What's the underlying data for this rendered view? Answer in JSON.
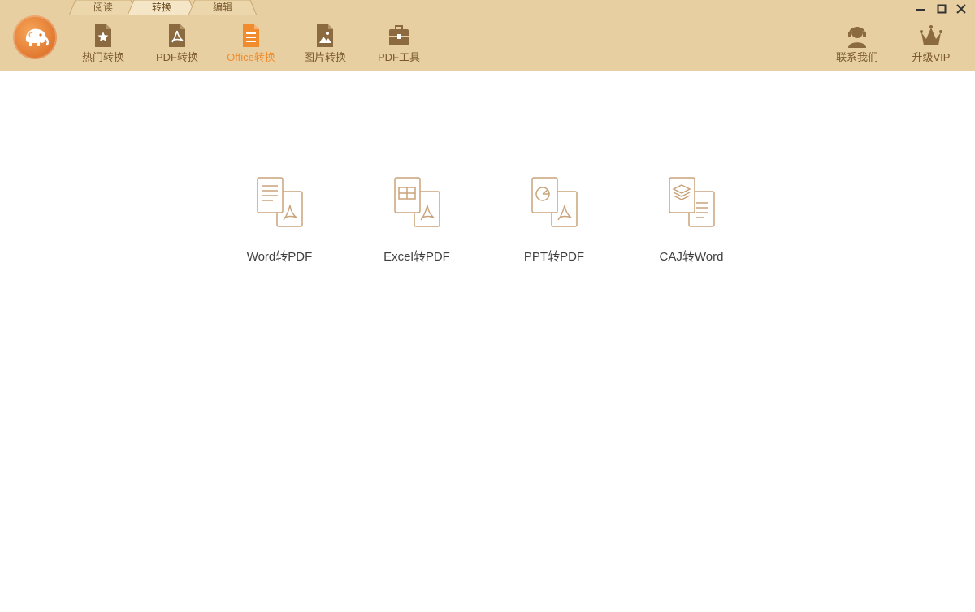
{
  "window": {
    "tabs": [
      {
        "label": "阅读",
        "active": false
      },
      {
        "label": "转换",
        "active": true
      },
      {
        "label": "编辑",
        "active": false
      }
    ],
    "controls": {
      "minimize": "—",
      "maximize": "□",
      "close": "✕"
    }
  },
  "toolbar": {
    "items": [
      {
        "label": "热门转换",
        "icon": "star-doc-icon",
        "active": false
      },
      {
        "label": "PDF转换",
        "icon": "pdf-doc-icon",
        "active": false
      },
      {
        "label": "Office转换",
        "icon": "office-doc-icon",
        "active": true
      },
      {
        "label": "图片转换",
        "icon": "image-doc-icon",
        "active": false
      },
      {
        "label": "PDF工具",
        "icon": "toolbox-icon",
        "active": false
      }
    ],
    "right": [
      {
        "label": "联系我们",
        "icon": "headset-icon"
      },
      {
        "label": "升级VIP",
        "icon": "crown-icon"
      }
    ]
  },
  "tools": [
    {
      "label": "Word转PDF",
      "icon": "word-to-pdf-icon"
    },
    {
      "label": "Excel转PDF",
      "icon": "excel-to-pdf-icon"
    },
    {
      "label": "PPT转PDF",
      "icon": "ppt-to-pdf-icon"
    },
    {
      "label": "CAJ转Word",
      "icon": "caj-to-word-icon"
    }
  ],
  "colors": {
    "toolbar_bg": "#e7cfa1",
    "accent": "#f08c2e",
    "icon_brown": "#8a6a3e",
    "tool_icon_stroke": "#c9a37a"
  }
}
